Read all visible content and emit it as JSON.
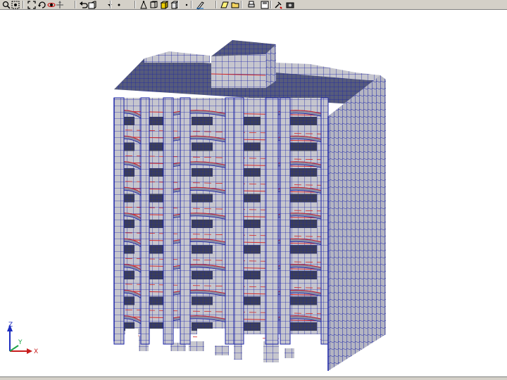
{
  "toolbar": {
    "buttons": [
      {
        "name": "zoom-icon"
      },
      {
        "name": "zoom-window-icon"
      },
      {
        "name": "zoom-extents-icon"
      },
      {
        "name": "rotate-view-icon"
      },
      {
        "name": "orbit-icon"
      },
      {
        "name": "pan-icon"
      },
      {
        "name": "undo-view-icon"
      },
      {
        "name": "view-direction-icon"
      },
      {
        "name": "dropdown-arrow-icon"
      },
      {
        "name": "point-icon"
      },
      {
        "name": "node-select-icon"
      },
      {
        "name": "wireframe-icon"
      },
      {
        "name": "solid-box-icon"
      },
      {
        "name": "shaded-box-icon"
      },
      {
        "name": "grid-snap-icon"
      },
      {
        "name": "pen-draw-icon"
      },
      {
        "name": "plane-icon"
      },
      {
        "name": "open-folder-icon"
      },
      {
        "name": "print-icon"
      },
      {
        "name": "save-disk-icon"
      },
      {
        "name": "tools-icon"
      },
      {
        "name": "screen-capture-icon"
      }
    ]
  },
  "axes": {
    "z_label": "Z",
    "y_label": "Y",
    "x_label": "X",
    "colors": {
      "z": "#1c2cbf",
      "y": "#1ea34a",
      "x": "#c81e1e"
    }
  },
  "model": {
    "floors": 9,
    "colors": {
      "mesh": "#1a23a8",
      "section_cut": "#d42828",
      "wall_face": "#c6c6ce",
      "roof": "#5a5f80",
      "shadow": "#3c3f58"
    }
  }
}
